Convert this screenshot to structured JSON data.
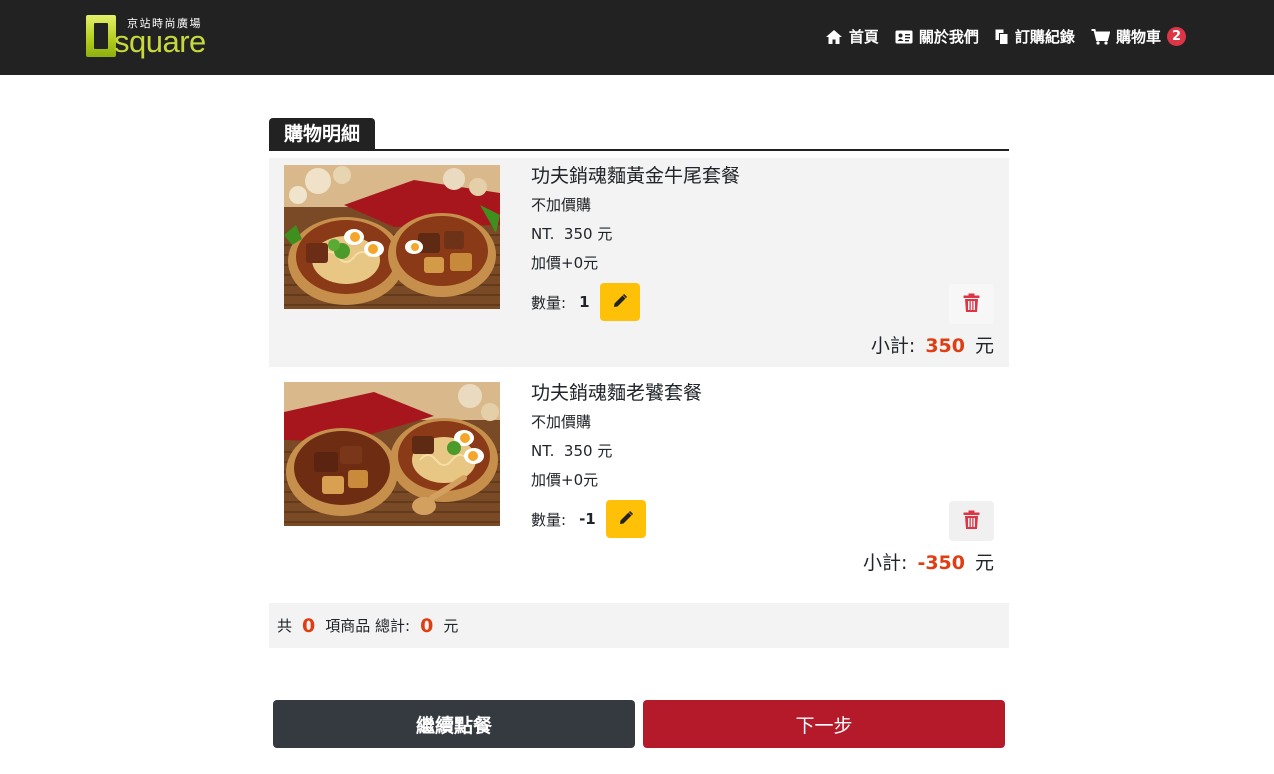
{
  "brand": {
    "chinese_name": "京站時尚廣場",
    "wordmark": "square",
    "logo_accent": "#c6d83a"
  },
  "nav": {
    "items": [
      {
        "label": "首頁",
        "icon": "home-icon"
      },
      {
        "label": "關於我們",
        "icon": "id-card-icon"
      },
      {
        "label": "訂購紀錄",
        "icon": "documents-icon"
      },
      {
        "label": "購物車",
        "icon": "cart-icon"
      }
    ],
    "cart_count": "2"
  },
  "section_title": "購物明細",
  "items": [
    {
      "name": "功夫銷魂麵黃金牛尾套餐",
      "addon": "不加價購",
      "price_prefix": "NT.",
      "price": "350",
      "price_unit": "元",
      "extra": "加價+0元",
      "qty_label": "數量:",
      "qty": "1",
      "subtotal_label": "小計:",
      "subtotal": "350",
      "subtotal_unit": "元"
    },
    {
      "name": "功夫銷魂麵老饕套餐",
      "addon": "不加價購",
      "price_prefix": "NT.",
      "price": "350",
      "price_unit": "元",
      "extra": "加價+0元",
      "qty_label": "數量:",
      "qty": "-1",
      "subtotal_label": "小計:",
      "subtotal": "-350",
      "subtotal_unit": "元"
    }
  ],
  "summary": {
    "prefix": "共",
    "count": "0",
    "count_suffix": "項商品 總計:",
    "total": "0",
    "total_unit": "元"
  },
  "actions": {
    "continue_label": "繼續點餐",
    "next_label": "下一步"
  },
  "colors": {
    "navbar": "#222222",
    "accent_price": "#e03d12",
    "edit_button": "#ffc107",
    "delete_icon": "#dc3545",
    "continue_button": "#343a40",
    "next_button": "#b51a2b"
  }
}
